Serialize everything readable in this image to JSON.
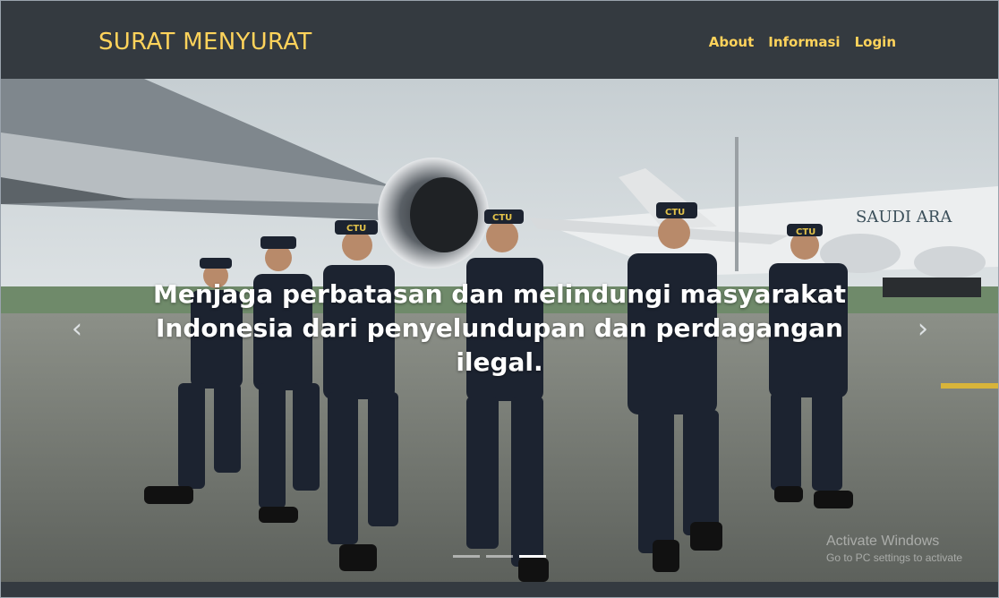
{
  "navbar": {
    "brand": "SURAT MENYURAT",
    "links": [
      {
        "label": "About"
      },
      {
        "label": "Informasi"
      },
      {
        "label": "Login"
      }
    ]
  },
  "carousel": {
    "caption": "Menjaga perbatasan dan melindungi masyarakat Indonesia dari penyelundupan dan perdagangan ilegal.",
    "prev_icon": "chevron-left-icon",
    "next_icon": "chevron-right-icon",
    "indicators_count": 3,
    "active_indicator": 3,
    "plane_livery": "SAUDI ARA",
    "cap_text": "CTU"
  },
  "watermark": {
    "title": "Activate Windows",
    "subtitle": "Go to PC settings to activate"
  },
  "colors": {
    "navbar_bg": "#343a40",
    "brand": "#ffd35b",
    "link": "#ffd35b",
    "caption": "#ffffff"
  }
}
